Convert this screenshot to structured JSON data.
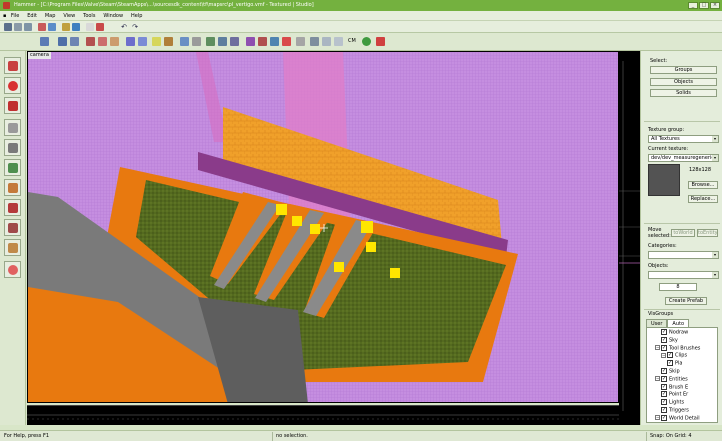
{
  "window": {
    "title": "Hammer - [C:\\Program Files\\Valve\\Steam\\SteamApps\\...\\sourcesdk_content\\tf\\mapsrc\\pl_vertigo.vmf - Textured | Studio]",
    "controls": [
      "_",
      "□",
      "×"
    ]
  },
  "menu": {
    "items": [
      "File",
      "Edit",
      "Map",
      "View",
      "Tools",
      "Window",
      "Help"
    ]
  },
  "toolbar": {
    "cm_label": "CM"
  },
  "viewport": {
    "camera_label": "camera"
  },
  "right_panel": {
    "select_label": "Select:",
    "groups_button": "Groups",
    "objects_button": "Objects",
    "solids_button": "Solids",
    "texture_group_label": "Texture group:",
    "texture_group_value": "All Textures",
    "current_texture_label": "Current texture:",
    "current_texture_value": "dev/dev_measuregeneric",
    "texture_size": "128x128",
    "browse_button": "Browse...",
    "replace_button": "Replace...",
    "move_selected_label": "Move selected:",
    "to_world_button": "toWorld",
    "to_entity_button": "toEntity",
    "categories_label": "Categories:",
    "objects_label": "Objects:",
    "number_value": "8",
    "create_prefab_button": "Create Prefab",
    "visgroups_label": "VisGroups",
    "tabs": [
      "User",
      "Auto"
    ],
    "tree": [
      {
        "label": "Nodraw",
        "indent": 2,
        "exp": false
      },
      {
        "label": "Sky",
        "indent": 2,
        "exp": false
      },
      {
        "label": "Tool Brushes",
        "indent": 1,
        "exp": true
      },
      {
        "label": "Clips",
        "indent": 2,
        "exp": true
      },
      {
        "label": "Pla",
        "indent": 3,
        "exp": false
      },
      {
        "label": "Skip",
        "indent": 2,
        "exp": false
      },
      {
        "label": "Entities",
        "indent": 1,
        "exp": true
      },
      {
        "label": "Brush E",
        "indent": 2,
        "exp": false
      },
      {
        "label": "Point Er",
        "indent": 2,
        "exp": false
      },
      {
        "label": "Lights",
        "indent": 2,
        "exp": false
      },
      {
        "label": "Triggers",
        "indent": 2,
        "exp": false
      },
      {
        "label": "World Detail",
        "indent": 1,
        "exp": true
      }
    ]
  },
  "status": {
    "help": "For Help, press F1",
    "selection": "no selection.",
    "snap": "Snap: On Grid: 4"
  }
}
